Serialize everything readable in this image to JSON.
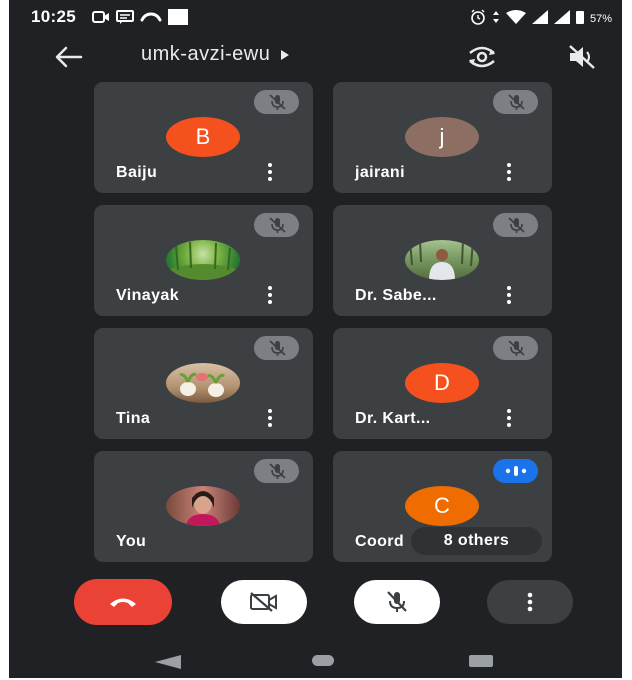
{
  "status_bar": {
    "time": "10:25",
    "battery": "57%"
  },
  "header": {
    "meeting_code": "umk-avzi-ewu"
  },
  "participants": [
    {
      "name": "Baiju",
      "initial": "B",
      "avatar_color": "#f4511e",
      "avatar": "letter",
      "muted": true
    },
    {
      "name": "jairani",
      "initial": "j",
      "avatar_color": "#8d6e63",
      "avatar": "letter",
      "muted": true
    },
    {
      "name": "Vinayak",
      "initial": "",
      "avatar_color": "#4caf50",
      "avatar": "photo-forest",
      "muted": true
    },
    {
      "name": "Dr. Sabe...",
      "initial": "",
      "avatar_color": "#6d8a5b",
      "avatar": "photo-person-outdoors",
      "muted": true
    },
    {
      "name": "Tina",
      "initial": "",
      "avatar_color": "#c8a37a",
      "avatar": "photo-plants",
      "muted": true
    },
    {
      "name": "Dr. Kart...",
      "initial": "D",
      "avatar_color": "#f4511e",
      "avatar": "letter",
      "muted": true
    },
    {
      "name": "You",
      "initial": "",
      "avatar_color": "#a34060",
      "avatar": "photo-woman",
      "muted": true
    },
    {
      "name": "Coord",
      "initial": "C",
      "avatar_color": "#ef6c00",
      "avatar": "letter",
      "muted": false
    }
  ],
  "others_label": "8 others",
  "colors": {
    "background": "#202124",
    "tile": "#3c4043",
    "end_call": "#ea4335",
    "speaking": "#1a73e8"
  },
  "controls": [
    "end-call",
    "camera-off",
    "mic-off",
    "more-options"
  ],
  "nav": [
    "back",
    "home",
    "recents"
  ]
}
